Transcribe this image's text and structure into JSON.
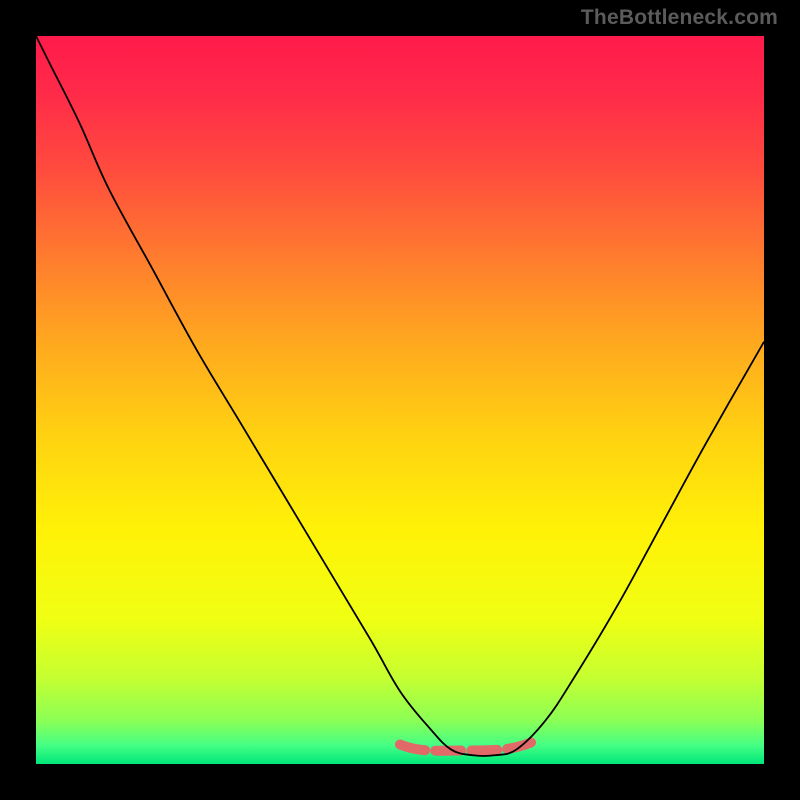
{
  "attribution": "TheBottleneck.com",
  "colors": {
    "gradient_stops": [
      {
        "offset": 0.0,
        "color": "#ff1a4b"
      },
      {
        "offset": 0.08,
        "color": "#ff2b49"
      },
      {
        "offset": 0.18,
        "color": "#ff4a3e"
      },
      {
        "offset": 0.3,
        "color": "#ff7a2f"
      },
      {
        "offset": 0.42,
        "color": "#ffa81f"
      },
      {
        "offset": 0.55,
        "color": "#ffd211"
      },
      {
        "offset": 0.68,
        "color": "#fff207"
      },
      {
        "offset": 0.8,
        "color": "#f0ff13"
      },
      {
        "offset": 0.88,
        "color": "#c6ff30"
      },
      {
        "offset": 0.94,
        "color": "#8cff55"
      },
      {
        "offset": 0.975,
        "color": "#43ff84"
      },
      {
        "offset": 1.0,
        "color": "#00e67a"
      }
    ],
    "curve": "#000000",
    "bottom_band": "#e16a68"
  },
  "chart_data": {
    "type": "line",
    "title": "",
    "xlabel": "",
    "ylabel": "",
    "xlim": [
      0,
      100
    ],
    "ylim": [
      0,
      100
    ],
    "series": [
      {
        "name": "bottleneck-curve",
        "x": [
          0,
          2,
          6,
          10,
          16,
          22,
          28,
          34,
          40,
          46,
          50,
          54,
          57,
          60,
          63,
          66,
          70,
          74,
          80,
          86,
          92,
          100
        ],
        "y": [
          100,
          96,
          88,
          79,
          68,
          57,
          47,
          37,
          27,
          17,
          10,
          5,
          2,
          1.2,
          1.2,
          2,
          6,
          12,
          22,
          33,
          44,
          58
        ]
      }
    ],
    "bottom_band": {
      "x_start": 50,
      "x_end": 68,
      "y": 2.4
    }
  }
}
